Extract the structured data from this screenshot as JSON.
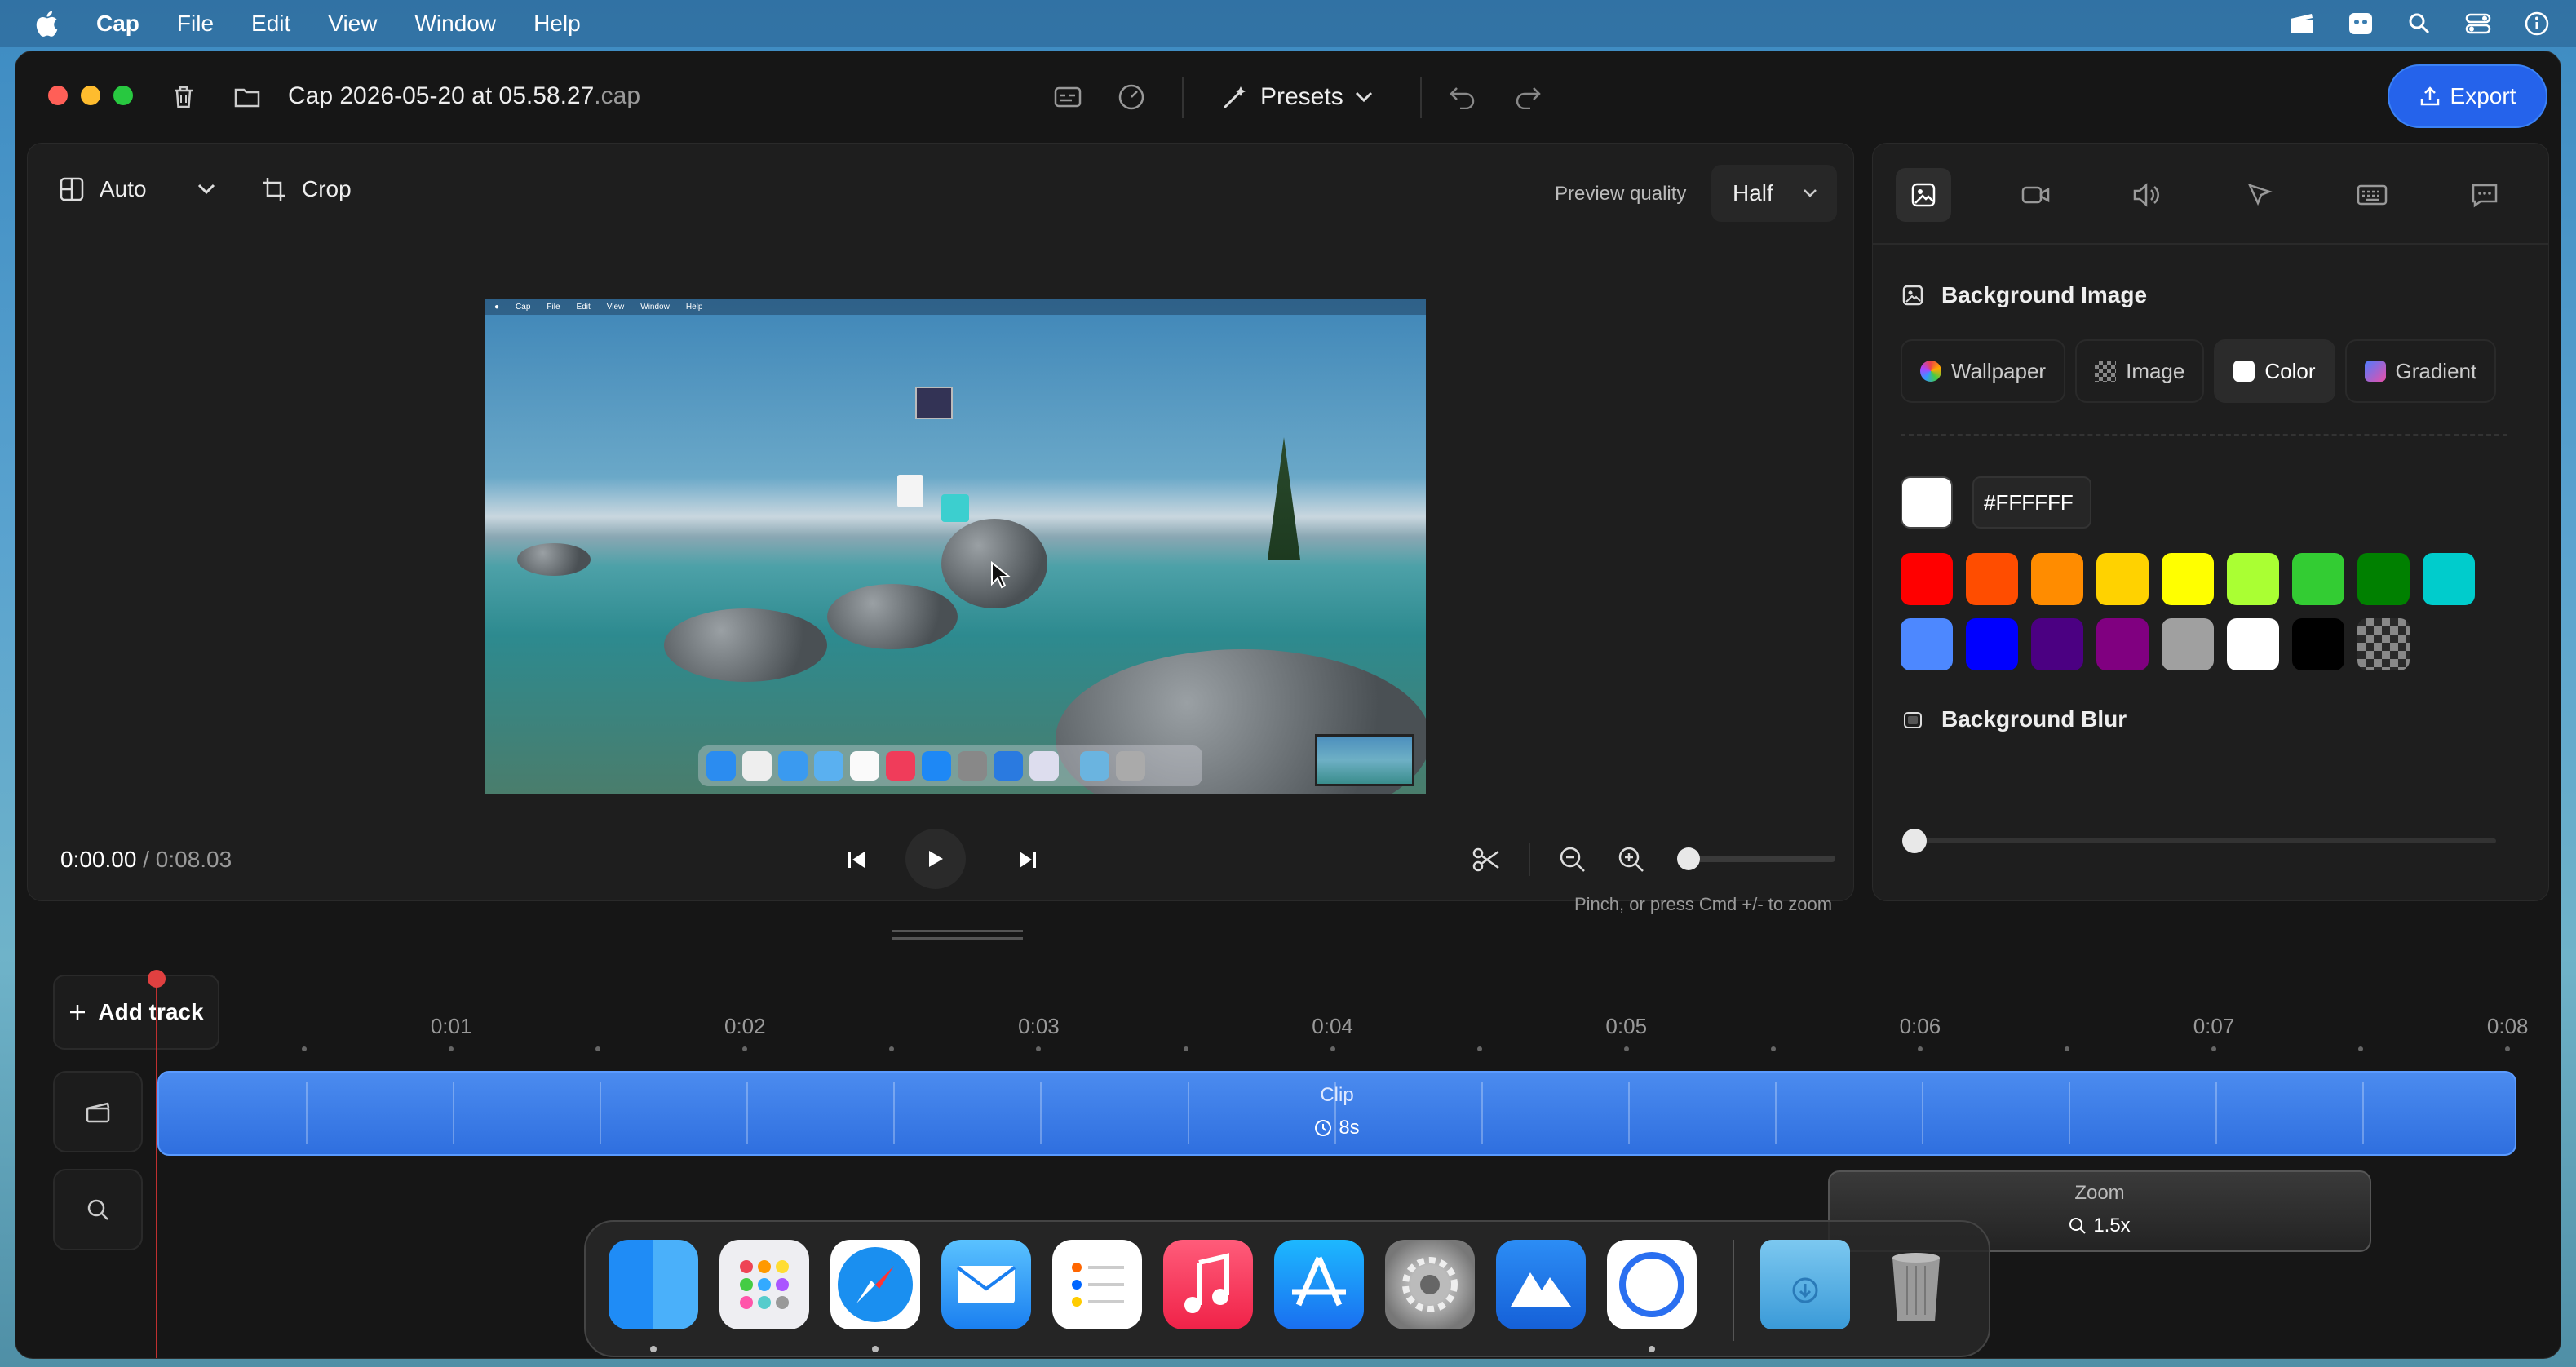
{
  "menubar": {
    "items": [
      "Cap",
      "File",
      "Edit",
      "View",
      "Window",
      "Help"
    ]
  },
  "window": {
    "title": "Cap 2026-05-20 at 05.58.27",
    "title_ext": ".cap",
    "presets_label": "Presets",
    "export_label": "Export"
  },
  "editor": {
    "aspect_label": "Auto",
    "crop_label": "Crop",
    "preview_quality_label": "Preview quality",
    "preview_quality_value": "Half",
    "time_current": "0:00.00",
    "time_separator": " / ",
    "time_total": "0:08.03",
    "zoom_hint": "Pinch, or press Cmd +/- to zoom",
    "zoom_level": 0.0
  },
  "preview_menubar": [
    "Cap",
    "File",
    "Edit",
    "View",
    "Window",
    "Help"
  ],
  "sidebar": {
    "bg_image_title": "Background Image",
    "bg_tabs": [
      {
        "label": "Wallpaper",
        "active": false
      },
      {
        "label": "Image",
        "active": false
      },
      {
        "label": "Color",
        "active": true
      },
      {
        "label": "Gradient",
        "active": false
      }
    ],
    "hex_value": "#FFFFFF",
    "swatches": [
      "#ff0000",
      "#ff4d00",
      "#ff8c00",
      "#ffd200",
      "#ffff00",
      "#aaff33",
      "#33cc33",
      "#008000",
      "#00cccc",
      "#4d88ff",
      "#0000ff",
      "#4b0082",
      "#800080",
      "#a0a0a0",
      "#ffffff",
      "#000000",
      "transparent"
    ],
    "bg_blur_title": "Background Blur",
    "bg_blur_value": 0
  },
  "timeline": {
    "add_track_label": "Add track",
    "ticks": [
      "0:01",
      "0:02",
      "0:03",
      "0:04",
      "0:05",
      "0:06",
      "0:07",
      "0:08"
    ],
    "clip_label": "Clip",
    "clip_duration": "8s",
    "zoom_label": "Zoom",
    "zoom_value": "1.5x"
  },
  "dock": {
    "apps": [
      "finder-icon",
      "launchpad-icon",
      "safari-icon",
      "mail-icon",
      "reminders-icon",
      "music-icon",
      "app-store-icon",
      "system-settings-icon",
      "mountain-app-icon",
      "cap-app-icon"
    ],
    "right": [
      "downloads-folder-icon",
      "trash-icon"
    ]
  },
  "colors": {
    "accent": "#2563eb",
    "playhead": "#e04040",
    "clip": "#3b7ee8"
  }
}
